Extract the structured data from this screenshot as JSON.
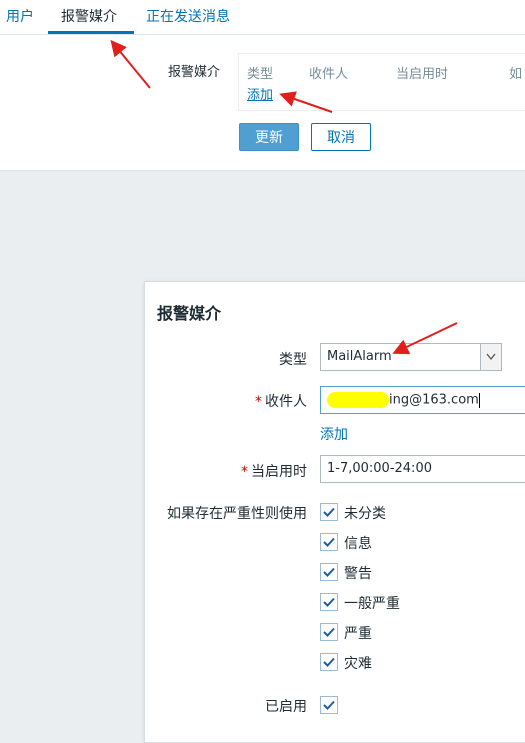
{
  "tabs": [
    {
      "label": "用户"
    },
    {
      "label": "报警媒介"
    },
    {
      "label": "正在发送消息"
    }
  ],
  "media": {
    "label": "报警媒介",
    "columns": [
      "类型",
      "收件人",
      "当启用时",
      "如"
    ],
    "add_link": "添加"
  },
  "buttons": {
    "update": "更新",
    "cancel": "取消"
  },
  "dialog": {
    "title": "报警媒介",
    "type_label": "类型",
    "type_value": "MailAlarm",
    "recipient_label": "收件人",
    "recipient_value": "ing@163.com",
    "recipient_add": "添加",
    "when_label": "当启用时",
    "when_value": "1-7,00:00-24:00",
    "severity_label": "如果存在严重性则使用",
    "severities": [
      {
        "label": "未分类",
        "checked": true
      },
      {
        "label": "信息",
        "checked": true
      },
      {
        "label": "警告",
        "checked": true
      },
      {
        "label": "一般严重",
        "checked": true
      },
      {
        "label": "严重",
        "checked": true
      },
      {
        "label": "灾难",
        "checked": true
      }
    ],
    "enabled_label": "已启用",
    "enabled_checked": true
  },
  "colors": {
    "accent": "#0275b8",
    "annotation": "#e0201b",
    "redaction": "#ffff00"
  }
}
